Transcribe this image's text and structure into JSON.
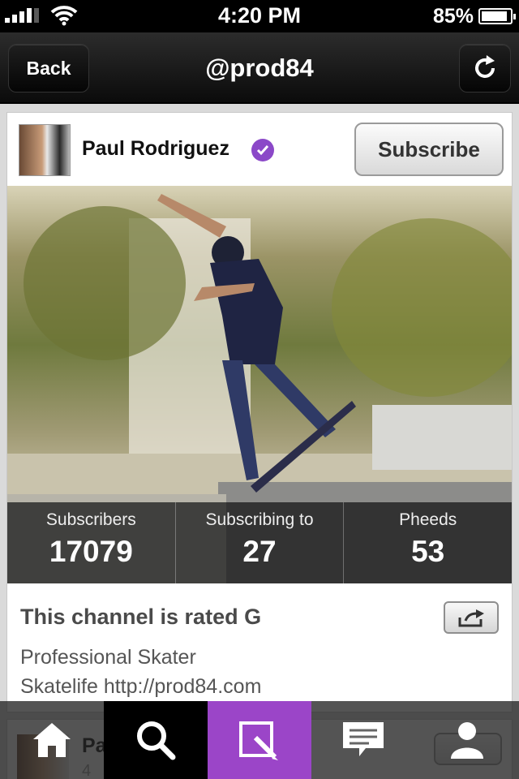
{
  "status_bar": {
    "time": "4:20 PM",
    "battery": "85%"
  },
  "nav": {
    "back_label": "Back",
    "title": "@prod84"
  },
  "channel": {
    "name": "Paul Rodriguez",
    "subscribe_label": "Subscribe",
    "stats": [
      {
        "label": "Subscribers",
        "value": "17079"
      },
      {
        "label": "Subscribing to",
        "value": "27"
      },
      {
        "label": "Pheeds",
        "value": "53"
      }
    ],
    "rating": "This channel is rated G",
    "bio_line1": "Professional Skater",
    "bio_line2": "Skatelife http://prod84.com"
  },
  "next_card": {
    "name": "Pa",
    "sub": "4"
  },
  "tabs": [
    {
      "name": "home-tab",
      "icon": "home-icon"
    },
    {
      "name": "search-tab",
      "icon": "search-icon"
    },
    {
      "name": "compose-tab",
      "icon": "compose-icon"
    },
    {
      "name": "messages-tab",
      "icon": "chat-icon"
    },
    {
      "name": "profile-tab",
      "icon": "user-icon"
    }
  ],
  "colors": {
    "accent": "#9b45c8",
    "verified": "#8b48c8"
  }
}
